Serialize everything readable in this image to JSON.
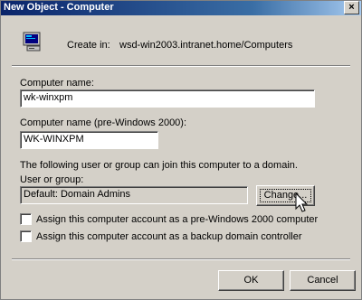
{
  "window": {
    "title": "New Object - Computer",
    "close_glyph": "×"
  },
  "header": {
    "icon": "computer-icon",
    "create_in_label": "Create in:",
    "create_in_path": "wsd-win2003.intranet.home/Computers"
  },
  "form": {
    "computer_name_label": "Computer name:",
    "computer_name_value": "wk-winxpm",
    "pre2000_label": "Computer name (pre-Windows 2000):",
    "pre2000_value": "WK-WINXPM",
    "join_note": "The following user or group can join this computer to a domain.",
    "user_group_label": "User or group:",
    "user_group_value": "Default: Domain Admins",
    "change_button": "Change...",
    "checkbox_pre2000_label": "Assign this computer account as a pre-Windows 2000 computer",
    "checkbox_pre2000_checked": false,
    "checkbox_bdc_label": "Assign this computer account as a backup domain controller",
    "checkbox_bdc_checked": false
  },
  "footer": {
    "ok_button": "OK",
    "cancel_button": "Cancel"
  },
  "colors": {
    "title_start": "#0a246a",
    "title_end": "#a6caf0",
    "face": "#d4d0c8"
  }
}
